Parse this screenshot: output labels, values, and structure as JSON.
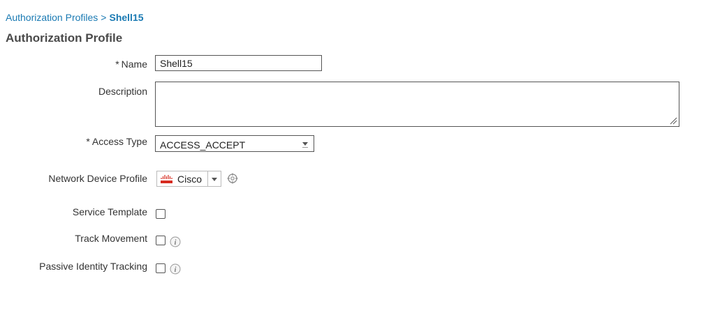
{
  "breadcrumb": {
    "parent": "Authorization Profiles",
    "separator": ">",
    "current": "Shell15"
  },
  "page_title": "Authorization Profile",
  "form": {
    "name": {
      "label": "Name",
      "required_marker": "*",
      "value": "Shell15"
    },
    "description": {
      "label": "Description",
      "value": ""
    },
    "access_type": {
      "label": "Access Type",
      "required_marker": "*",
      "value": "ACCESS_ACCEPT"
    },
    "network_device_profile": {
      "label": "Network Device Profile",
      "value": "Cisco",
      "icon": "cisco-logo-icon"
    },
    "service_template": {
      "label": "Service Template",
      "checked": false
    },
    "track_movement": {
      "label": "Track Movement",
      "checked": false,
      "info_icon": "info-icon"
    },
    "passive_identity_tracking": {
      "label": "Passive Identity Tracking",
      "checked": false,
      "info_icon": "info-icon"
    }
  },
  "colors": {
    "link": "#1a7ab3",
    "cisco_red": "#d62b1f",
    "text": "#333333"
  }
}
